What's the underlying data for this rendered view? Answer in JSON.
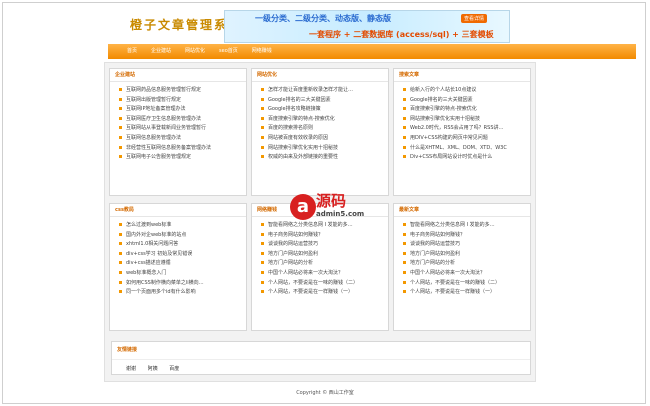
{
  "site": {
    "logo": "橙子文章管理系统",
    "banner_line1": "一级分类、二级分类、动态版、静态版",
    "banner_badge": "查看详情",
    "banner_line2": "一套程序 + 二套数据库 (access/sql) + 三套模板"
  },
  "nav": [
    "首页",
    "企业建站",
    "网站优化",
    "seo首页",
    "网络赚钱"
  ],
  "panels": [
    {
      "title": "企业建站",
      "items": [
        "互联网药品信息服务管理暂行规定",
        "互联网出版管理暂行规定",
        "互联网IP地址备案管理办法",
        "互联网医疗卫生信息服务管理办法",
        "互联网站从事登载新闻业务管理暂行",
        "互联网信息服务管理办法",
        "非经营性互联网信息服务备案管理办法",
        "互联网电子公告服务管理规定"
      ]
    },
    {
      "title": "网站优化",
      "items": [
        "怎样才能让百度重新收录怎样才能让…",
        "Google排名的三大关键因素",
        "Google排名攻略链接策",
        "百度搜索引擎的特点-搜索优化",
        "百度的搜索排名原则",
        "网站被百度有效收录的原因",
        "网站搜索引擎优化实用十招秘技",
        "权威的由来及外部链接的重要性"
      ]
    },
    {
      "title": "搜索文章",
      "items": [
        "给新入行的个人站长10点建议",
        "Google排名的三大关键因素",
        "百度搜索引擎的特点-搜索优化",
        "网站搜索引擎优化实用十招秘技",
        "Web2.0时代，RSS会占用了吗？RSS讲…",
        "用DIV+CSS构建的网页中常见问题",
        "什么是XHTML、XML、DOM、XTD、W3C",
        "Div+CSS布局网站设计时优点是什么"
      ]
    },
    {
      "title": "css教局",
      "items": [
        "怎么过渡到web标准",
        "国内外对企web标准的站点",
        "xhtml1.0相关问题问答",
        "div+css学习  初始及常见错误",
        "div+css描述应遵循",
        "web标准概念入门",
        "如何用CSS制作横向菜单之li横向…",
        "同一个页面用多个id有什么影响"
      ]
    },
    {
      "title": "网络赚钱",
      "items": [
        "智能看网络之分类信息网 I 发能的多…",
        "电子商务网站如何赚钱？",
        "谈谈我的网站运营技巧",
        "地方门户网站如何盈利",
        "地方门户网站的分析",
        "中国个人网站必将来一次大淘汰？",
        "个人网站，不要说是在一味的赚钱（二）",
        "个人网站，不要说是在一样赚钱（一）"
      ]
    },
    {
      "title": "最新文章",
      "items": [
        "智能看网络之分类信息网 I 发能的多…",
        "电子商务网站如何赚钱？",
        "谈谈我的网站运营技巧",
        "地方门户网站如何盈利",
        "地方门户网站的分析",
        "中国个人网站必将来一次大淘汰？",
        "个人网站，不要说是在一味的赚钱（二）",
        "个人网站，不要说是在一样赚钱（一）"
      ]
    }
  ],
  "friend_links": {
    "title": "友情链接",
    "links": [
      "谢谢",
      "阿姨",
      "百度"
    ]
  },
  "watermark": {
    "letter": "a",
    "text": "源码",
    "sub": "admin5.com"
  },
  "footer": "Copyright © 西山工作室"
}
